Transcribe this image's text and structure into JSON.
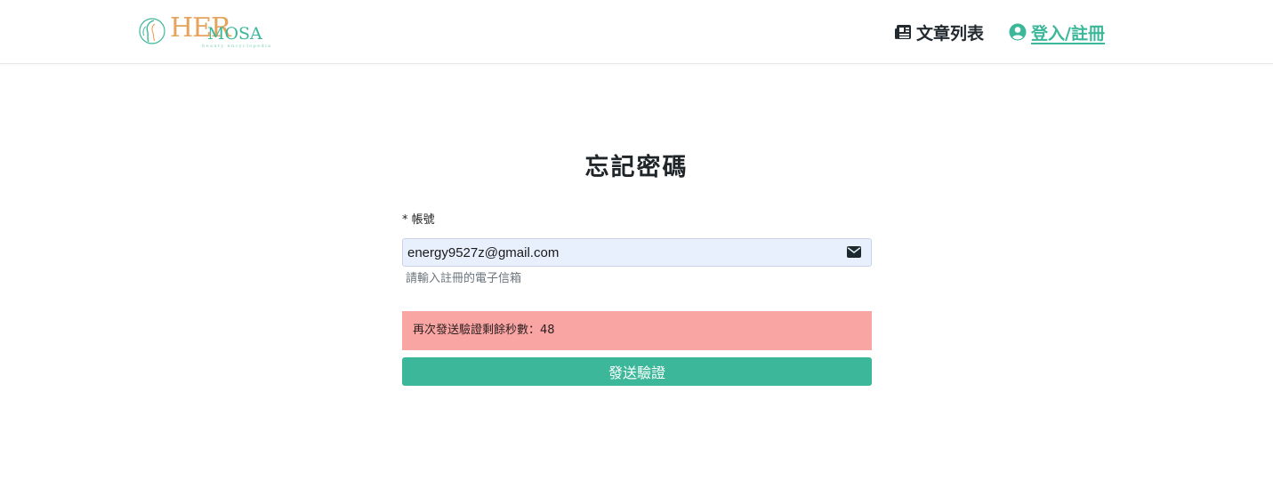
{
  "header": {
    "logo": {
      "text_her": "HER",
      "text_mosa": "MOSA",
      "tagline": "beauty encyclopedia",
      "emblem_icon": "woman-silhouette-icon"
    },
    "nav": {
      "articles": {
        "label": "文章列表",
        "icon": "newspaper-icon"
      },
      "login": {
        "label": "登入/註冊",
        "icon": "user-circle-icon"
      }
    }
  },
  "main": {
    "title": "忘記密碼",
    "account_field": {
      "label": "* 帳號",
      "value": "energy9527z@gmail.com",
      "icon": "envelope-icon",
      "help": "請輸入註冊的電子信箱"
    },
    "alert": {
      "text": "再次發送驗證剩餘秒數：48",
      "seconds_remaining": 48
    },
    "send_button_label": "發送驗證"
  },
  "colors": {
    "brand_green": "#3cb79a",
    "brand_gold": "#e6a35c",
    "alert_bg": "#f8a5a4",
    "input_bg": "#e8f0fe",
    "nav_dark": "#222a30"
  }
}
